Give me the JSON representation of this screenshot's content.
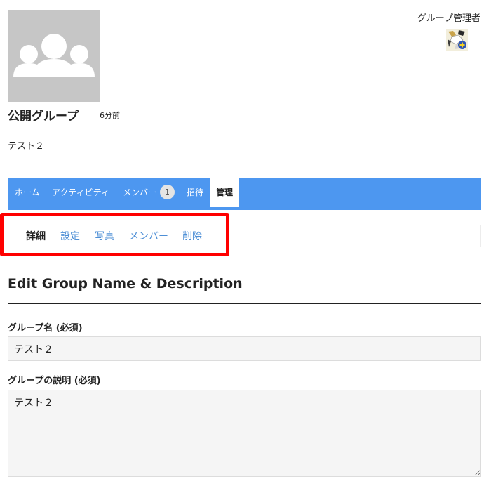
{
  "group": {
    "name": "公開グループ",
    "last_active": "6分前",
    "description": "テスト２"
  },
  "admin": {
    "label": "グループ管理者"
  },
  "main_nav": {
    "items": [
      {
        "label": "ホーム"
      },
      {
        "label": "アクティビティ"
      },
      {
        "label": "メンバー",
        "count": "1"
      },
      {
        "label": "招待"
      },
      {
        "label": "管理",
        "active": true
      }
    ]
  },
  "sub_nav": {
    "items": [
      {
        "label": "詳細",
        "current": true
      },
      {
        "label": "設定"
      },
      {
        "label": "写真"
      },
      {
        "label": "メンバー"
      },
      {
        "label": "削除"
      }
    ]
  },
  "form": {
    "title": "Edit Group Name & Description",
    "name_label": "グループ名 (必須)",
    "name_value": "テスト２",
    "desc_label": "グループの説明 (必須)",
    "desc_value": "テスト２"
  },
  "colors": {
    "nav_background": "#4d97f0",
    "link": "#4e8fd6",
    "highlight_border": "#ff0000"
  },
  "icons": {
    "group_avatar": "group-people-icon",
    "admin_avatar": "identicon-avatar-icon"
  }
}
